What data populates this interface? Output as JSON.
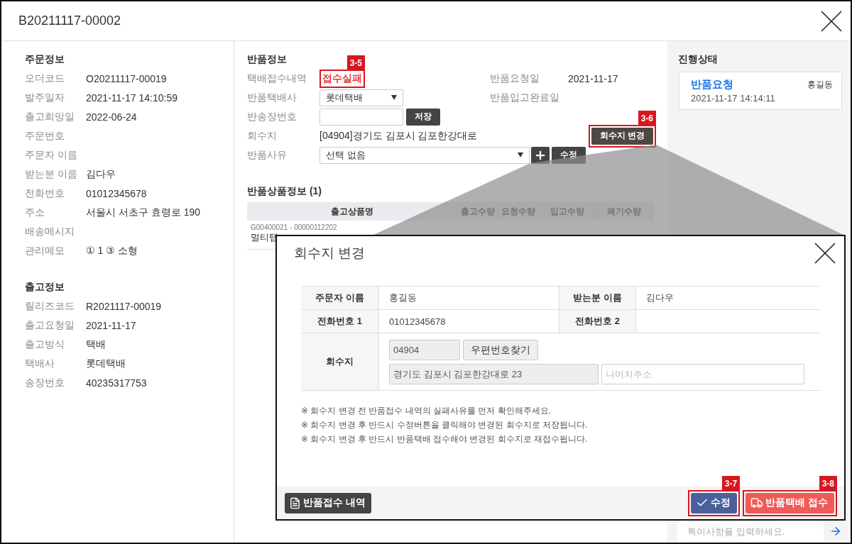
{
  "window": {
    "title": "B20211117-00002"
  },
  "order_info": {
    "heading": "주문정보",
    "fields": [
      {
        "label": "오더코드",
        "value": "O20211117-00019"
      },
      {
        "label": "발주일자",
        "value": "2021-11-17 14:10:59"
      },
      {
        "label": "출고희망일",
        "value": "2022-06-24"
      },
      {
        "label": "주문번호"
      },
      {
        "label": "주문자 이름"
      },
      {
        "label": "받는분 이름",
        "value": "김다우"
      },
      {
        "label": "전화번호",
        "value": "01012345678"
      },
      {
        "label": "주소",
        "value": "서울시 서초구 효령로 190"
      },
      {
        "label": "배송메시지"
      },
      {
        "label": "관리메모",
        "value": "① 1   ③ 소형"
      }
    ]
  },
  "release_info": {
    "heading": "출고정보",
    "fields": [
      {
        "label": "릴리즈코드",
        "value": "R2021117-00019"
      },
      {
        "label": "출고요청일",
        "value": "2021-11-17"
      },
      {
        "label": "출고방식",
        "value": "택배"
      },
      {
        "label": "택배사",
        "value": "롯데택배"
      },
      {
        "label": "송장번호",
        "value": "40235317753"
      }
    ]
  },
  "return_info": {
    "heading": "반품정보",
    "courier_status": {
      "label": "택배접수내역",
      "value": "접수실패",
      "callout": "3-5"
    },
    "request_date": {
      "label": "반품요청일",
      "value": "2021-11-17"
    },
    "complete_date": {
      "label": "반품입고완료일"
    },
    "courier": {
      "label": "반품택배사",
      "value": "롯데택배"
    },
    "tracking": {
      "label": "반송장번호",
      "button": "저장"
    },
    "pickup": {
      "label": "회수지",
      "value": "[04904]경기도 김포시 김포한강대로",
      "button": "회수지 변경",
      "callout": "3-6"
    },
    "reason": {
      "label": "반품사유",
      "value": "선택 없음",
      "button": "수정"
    }
  },
  "return_items": {
    "heading": "반품상품정보 (1)",
    "columns": [
      "출고상품명",
      "출고수량",
      "요청수량",
      "입고수량",
      "폐기수량"
    ],
    "rows": [
      {
        "code": "G00400021 - 00000112202",
        "name": "멀티탭"
      }
    ]
  },
  "progress": {
    "heading": "진행상태",
    "entries": [
      {
        "status": "반품요청",
        "user": "홍길동",
        "time": "2021-11-17 14:14:11"
      }
    ],
    "memo_placeholder": "특이사항을 입력하세요."
  },
  "dialog": {
    "title": "회수지 변경",
    "orderer_label": "주문자 이름",
    "orderer": "홍길동",
    "receiver_label": "받는분 이름",
    "receiver": "김다우",
    "phone1_label": "전화번호 1",
    "phone1": "01012345678",
    "phone2_label": "전화번호 2",
    "address_label": "회수지",
    "zip": "04904",
    "zip_button": "우편번호찾기",
    "address": "경기도 김포시 김포한강대로 23",
    "detail_placeholder": "나머지주소",
    "notes": [
      "※ 회수지 변경 전 반품접수 내역의 실패사유를 먼저 확인해주세요.",
      "※ 회수지 변경 후 반드시 수정버튼을 클릭해야 변경된 회수지로 저장됩니다.",
      "※ 회수지 변경 후 반드시 반품택배 접수해야 변경된 회수지로 재접수됩니다."
    ],
    "history_button": "반품접수 내역",
    "save_button": {
      "label": "수정",
      "callout": "3-7"
    },
    "courier_button": {
      "label": "반품택배 접수",
      "callout": "3-8"
    }
  }
}
